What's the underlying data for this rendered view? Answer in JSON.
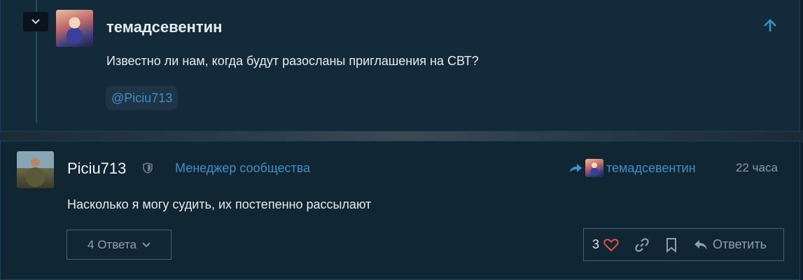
{
  "quoted_post": {
    "author": "темадсевентин",
    "text": "Известно ли нам, когда будут разосланы приглашения на СВТ?",
    "mention": "@Piciu713"
  },
  "post": {
    "author": "Piciu713",
    "role": "Менеджер сообщества",
    "reply_to": "темадсевентин",
    "time": "22 часа",
    "text": "Насколько я могу судить, их постепенно рассылают",
    "replies_label": "4 Ответа",
    "like_count": "3",
    "reply_label": "Ответить"
  },
  "colors": {
    "accent": "#3d8fc7",
    "like": "#e05050"
  },
  "icons": [
    "chevron-down-icon",
    "arrow-up-icon",
    "shield-icon",
    "reply-arrow-icon",
    "heart-icon",
    "link-icon",
    "bookmark-icon",
    "reply-icon"
  ]
}
